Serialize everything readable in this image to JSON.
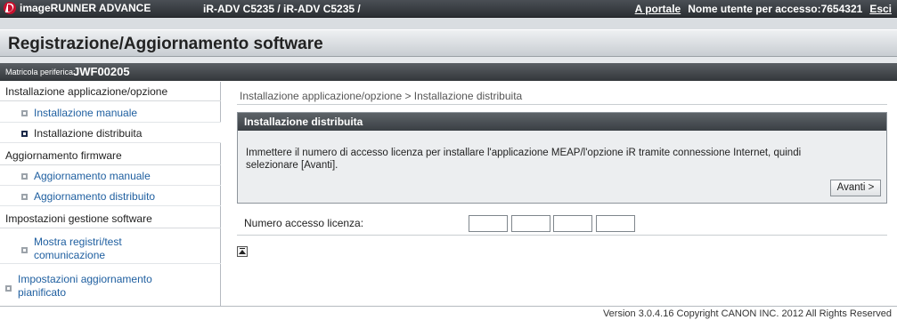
{
  "app": {
    "brand": "imageRUNNER ADVANCE",
    "model": "iR-ADV C5235 / iR-ADV C5235 /",
    "portal_link": "A portale",
    "user_info": "Nome utente per accesso:7654321",
    "logout_link": "Esci"
  },
  "page": {
    "title": "Registrazione/Aggiornamento software",
    "serial_label": "Matricola periferica:",
    "serial_value": "JWF00205"
  },
  "sidebar": {
    "section1": "Installazione applicazione/opzione",
    "item_manual_install": "Installazione manuale",
    "item_distributed_install": "Installazione distribuita",
    "section2": "Aggiornamento firmware",
    "item_manual_update": "Aggiornamento manuale",
    "item_distributed_update": "Aggiornamento distribuito",
    "section3": "Impostazioni gestione software",
    "item_logs_line1": "Mostra registri/test",
    "item_logs_line2": "comunicazione",
    "item_scheduled_line1": "Impostazioni aggiornamento",
    "item_scheduled_line2": "pianificato"
  },
  "main": {
    "breadcrumb": "Installazione applicazione/opzione > Installazione distribuita",
    "panel_title": "Installazione distribuita",
    "panel_text_line1": "Immettere il numero di accesso licenza per installare l'applicazione MEAP/l'opzione iR tramite connessione Internet, quindi",
    "panel_text_line2": "selezionare [Avanti].",
    "next_button": "Avanti >",
    "license_label": "Numero accesso licenza:",
    "license_fields": [
      "",
      "",
      "",
      ""
    ]
  },
  "footer": {
    "text": "Version 3.0.4.16 Copyright CANON INC. 2012 All Rights Reserved"
  },
  "colors": {
    "link_blue": "#1f5fa0",
    "canon_red": "#c8102e"
  }
}
